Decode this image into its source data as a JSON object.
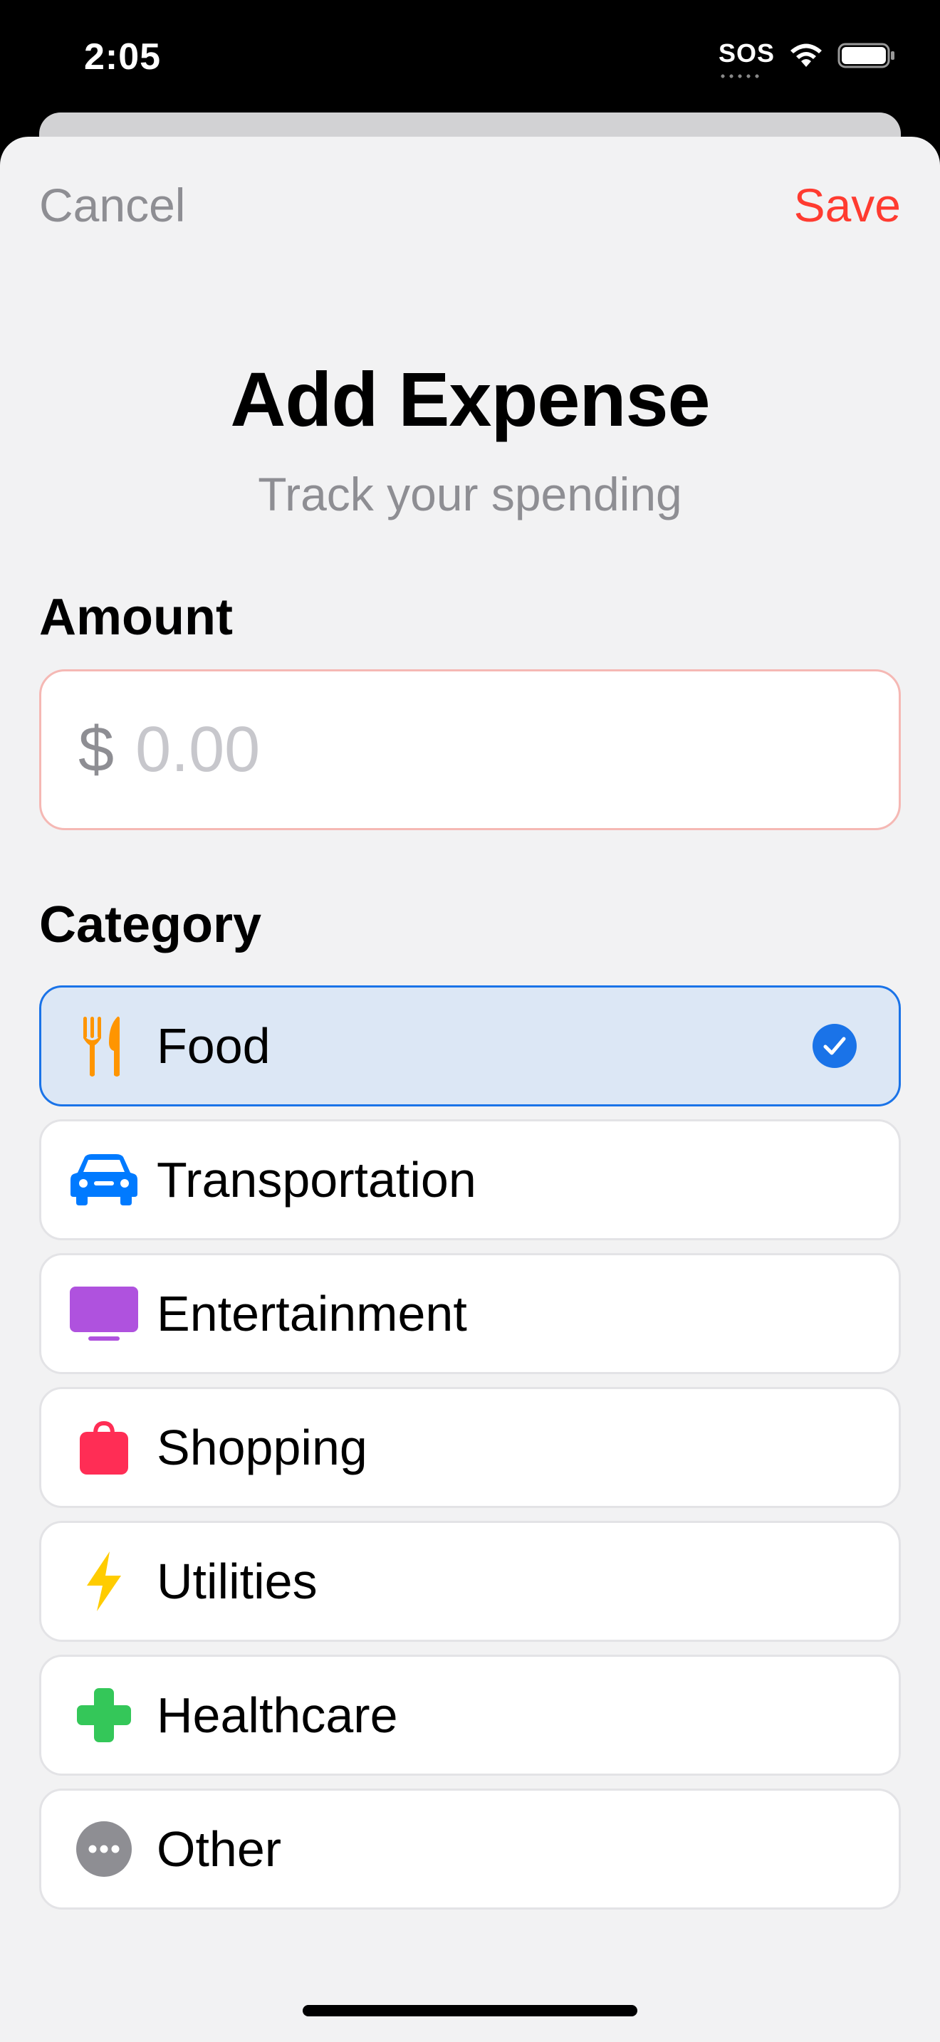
{
  "status_bar": {
    "time": "2:05",
    "sos": "SOS",
    "icons": [
      "wifi-icon",
      "battery-icon"
    ]
  },
  "nav": {
    "cancel_label": "Cancel",
    "save_label": "Save"
  },
  "header": {
    "title": "Add Expense",
    "subtitle": "Track your spending"
  },
  "amount": {
    "label": "Amount",
    "currency_symbol": "$",
    "placeholder": "0.00",
    "value": ""
  },
  "category": {
    "label": "Category",
    "selected": "Food",
    "items": [
      {
        "label": "Food",
        "icon": "fork-knife-icon",
        "color": "#ff9500",
        "selected": true
      },
      {
        "label": "Transportation",
        "icon": "car-icon",
        "color": "#007aff",
        "selected": false
      },
      {
        "label": "Entertainment",
        "icon": "tv-icon",
        "color": "#af52de",
        "selected": false
      },
      {
        "label": "Shopping",
        "icon": "bag-icon",
        "color": "#ff2d55",
        "selected": false
      },
      {
        "label": "Utilities",
        "icon": "bolt-icon",
        "color": "#ffcc00",
        "selected": false
      },
      {
        "label": "Healthcare",
        "icon": "cross-icon",
        "color": "#34c759",
        "selected": false
      },
      {
        "label": "Other",
        "icon": "ellipsis-circle-icon",
        "color": "#8e8e93",
        "selected": false
      }
    ]
  },
  "colors": {
    "accent_blue": "#1a73e8",
    "save_red": "#ff3b30",
    "secondary_gray": "#8e8e93",
    "sheet_background": "#f2f2f3"
  }
}
